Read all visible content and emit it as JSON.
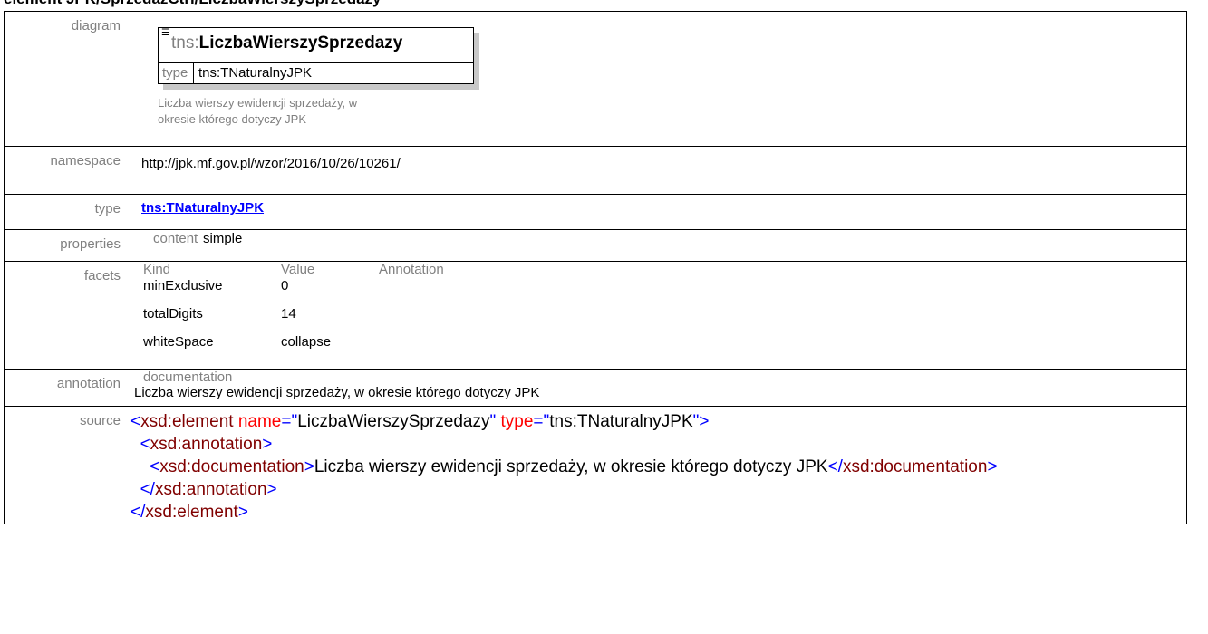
{
  "heading": "element JPK/SprzedazCtrl/LiczbaWierszySprzedazy",
  "labels": {
    "diagram": "diagram",
    "namespace": "namespace",
    "type": "type",
    "properties": "properties",
    "facets": "facets",
    "annotation": "annotation",
    "source": "source"
  },
  "diagram": {
    "prefix": "tns:",
    "name": "LiczbaWierszySprzedazy",
    "type_key": "type",
    "type_value": "tns:TNaturalnyJPK",
    "doc_line1": "Liczba wierszy ewidencji sprzedaży, w",
    "doc_line2": "okresie którego dotyczy JPK"
  },
  "namespace": "http://jpk.mf.gov.pl/wzor/2016/10/26/10261/",
  "type_link": "tns:TNaturalnyJPK",
  "properties": {
    "key": "content",
    "value": "simple"
  },
  "facets": {
    "headers": [
      "Kind",
      "Value",
      "Annotation"
    ],
    "rows": [
      {
        "kind": "minExclusive",
        "value": "0"
      },
      {
        "kind": "totalDigits",
        "value": "14"
      },
      {
        "kind": "whiteSpace",
        "value": "collapse"
      }
    ]
  },
  "annotation": {
    "label": "documentation",
    "text": "Liczba wierszy ewidencji sprzedaży, w okresie którego dotyczy JPK"
  },
  "source": {
    "element_tag": "xsd:element",
    "name_attr": "name",
    "name_val": "LiczbaWierszySprzedazy",
    "type_attr": "type",
    "type_val": "tns:TNaturalnyJPK",
    "annotation_tag": "xsd:annotation",
    "documentation_tag": "xsd:documentation",
    "doc_text": "Liczba wierszy ewidencji sprzedaży, w okresie którego dotyczy JPK"
  },
  "colors": {
    "tag": "#800000",
    "bracket": "#0000ff",
    "attr": "#ff0000",
    "link": "#0000ff",
    "label": "#808080"
  }
}
